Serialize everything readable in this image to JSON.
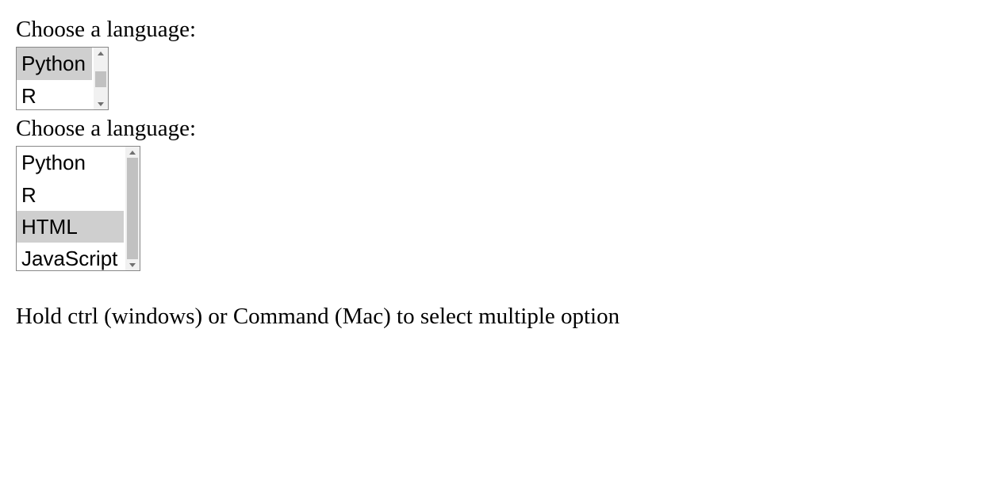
{
  "label1": "Choose a language:",
  "label2": "Choose a language:",
  "listbox1": {
    "options": [
      "Python",
      "R"
    ],
    "selectedIndexes": [
      0
    ]
  },
  "listbox2": {
    "options": [
      "Python",
      "R",
      "HTML",
      "JavaScript"
    ],
    "selectedIndexes": [
      2
    ]
  },
  "hint": "Hold ctrl (windows) or Command (Mac) to select multiple option"
}
